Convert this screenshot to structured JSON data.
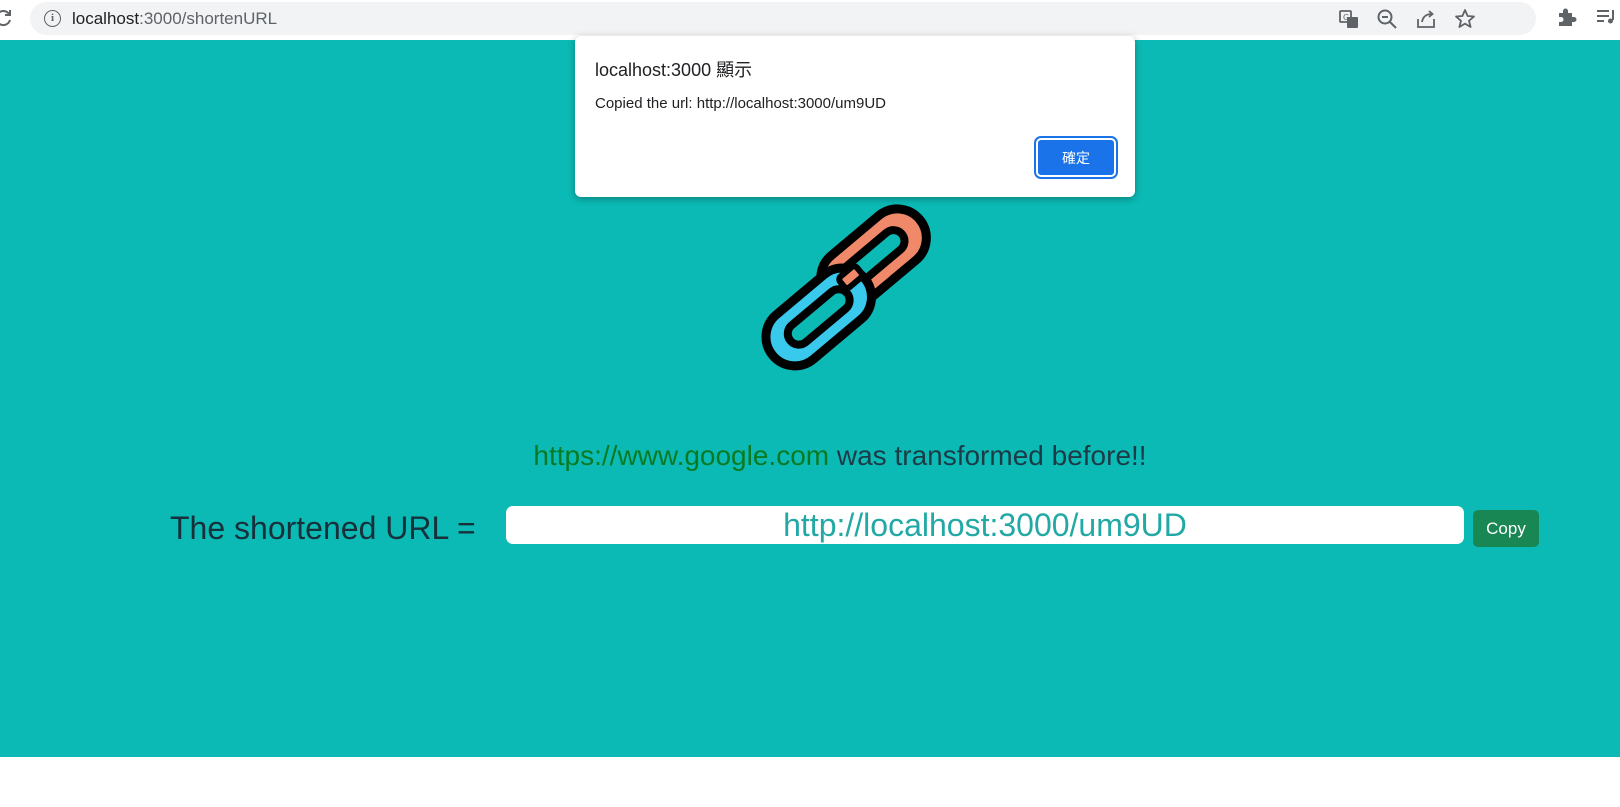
{
  "browser": {
    "url_host": "localhost",
    "url_path": ":3000/shortenURL",
    "icons": [
      "reload-icon",
      "site-info-icon",
      "translate-icon",
      "zoom-out-icon",
      "share-icon",
      "bookmark-star-icon",
      "extensions-icon",
      "reading-list-icon"
    ]
  },
  "page": {
    "background": "#0bbab5",
    "logo_icon": "chain-link-icon",
    "original_url": "https://www.google.com",
    "message_suffix": " was transformed before!!",
    "label": "The shortened URL =",
    "short_url": "http://localhost:3000/um9UD",
    "copy_label": "Copy"
  },
  "dialog": {
    "title": "localhost:3000 顯示",
    "message": "Copied the url: http://localhost:3000/um9UD",
    "ok_label": "確定"
  }
}
